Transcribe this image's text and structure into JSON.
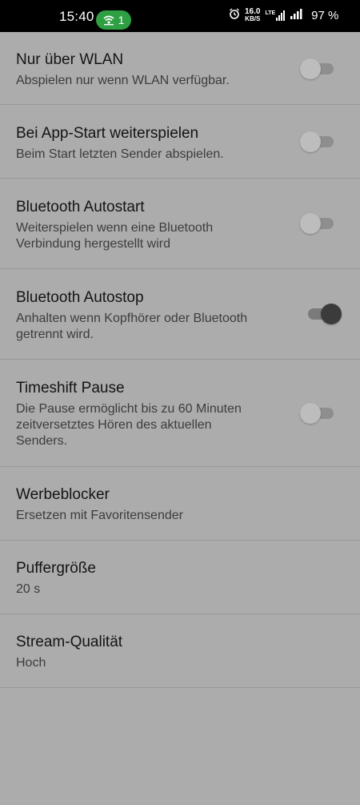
{
  "status_bar": {
    "time": "15:40",
    "hotspot_count": "1",
    "net_speed_value": "16.0",
    "net_speed_unit": "KB/S",
    "network_type": "LTE",
    "battery": "97 %"
  },
  "settings": [
    {
      "title": "Nur über WLAN",
      "subtitle": "Abspielen nur wenn WLAN verfügbar.",
      "toggle": false
    },
    {
      "title": "Bei App-Start weiterspielen",
      "subtitle": "Beim Start letzten Sender abspielen.",
      "toggle": false
    },
    {
      "title": "Bluetooth Autostart",
      "subtitle_lines": [
        "Weiterspielen wenn eine Bluetooth",
        "Verbindung hergestellt wird"
      ],
      "toggle": false
    },
    {
      "title": "Bluetooth Autostop",
      "subtitle_lines": [
        "Anhalten wenn Kopfhörer oder Bluetooth",
        "getrennt wird."
      ],
      "toggle": true
    },
    {
      "title": "Timeshift Pause",
      "subtitle_lines": [
        "Die Pause ermöglicht bis zu 60 Minuten",
        "zeitversetztes Hören des aktuellen",
        "Senders."
      ],
      "toggle": false
    },
    {
      "title": "Werbeblocker",
      "subtitle": "Ersetzen mit Favoritensender"
    },
    {
      "title": "Puffergröße",
      "subtitle": "20 s"
    },
    {
      "title": "Stream-Qualität",
      "subtitle": "Hoch"
    }
  ]
}
